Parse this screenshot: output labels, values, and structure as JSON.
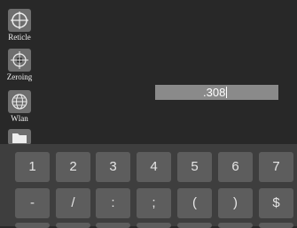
{
  "sidebar": {
    "items": [
      {
        "label": "Reticle",
        "icon": "reticle-icon"
      },
      {
        "label": "Zeroing",
        "icon": "zeroing-icon"
      },
      {
        "label": "Wlan",
        "icon": "globe-icon"
      },
      {
        "label": "",
        "icon": "folder-icon"
      }
    ]
  },
  "input": {
    "value": ".308"
  },
  "keyboard": {
    "row1": [
      "1",
      "2",
      "3",
      "4",
      "5",
      "6",
      "7"
    ],
    "row2": [
      "-",
      "/",
      ":",
      ";",
      "(",
      ")",
      "$"
    ]
  },
  "colors": {
    "background": "#282828",
    "keyboard_bg": "#3e3e3e",
    "key_bg": "#5d5d5d",
    "field_bg": "#8a8a8a"
  }
}
